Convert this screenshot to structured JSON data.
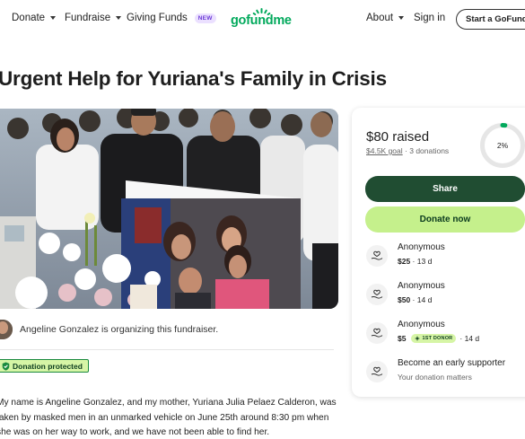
{
  "nav": {
    "donate": "Donate",
    "fundraise": "Fundraise",
    "giving_funds": "Giving Funds",
    "new_badge": "NEW",
    "logo": "gofundme",
    "about": "About",
    "sign_in": "Sign in",
    "start": "Start a GoFundMe"
  },
  "title": "Urgent Help for Yuriana's Family in Crisis",
  "organizer": {
    "text": "Angeline Gonzalez is organizing this fundraiser."
  },
  "protected_label": "Donation protected",
  "story": [
    "My name is Angeline Gonzalez, and my mother, Yuriana Julia Pelaez Calderon, was",
    "taken by masked men in an unmarked vehicle on June 25th around 8:30 pm when",
    "she was on her way to work, and we have not been able to find her."
  ],
  "card": {
    "raised": "$80 raised",
    "goal": "$4.5K goal",
    "donations": "3 donations",
    "percent_label": "2%",
    "percent": 0.02,
    "share": "Share",
    "donate": "Donate now",
    "donors": [
      {
        "name": "Anonymous",
        "amount": "$25",
        "when": "13 d",
        "badge": ""
      },
      {
        "name": "Anonymous",
        "amount": "$50",
        "when": "14 d",
        "badge": ""
      },
      {
        "name": "Anonymous",
        "amount": "$5",
        "when": "14 d",
        "badge": "1ST DONOR"
      }
    ],
    "early": {
      "title": "Become an early supporter",
      "subtitle": "Your donation matters"
    }
  },
  "colors": {
    "brand_green": "#02a95c",
    "share_bg": "#204d32",
    "donate_bg": "#c5f08c",
    "protected_bg": "#d6f5a6"
  }
}
